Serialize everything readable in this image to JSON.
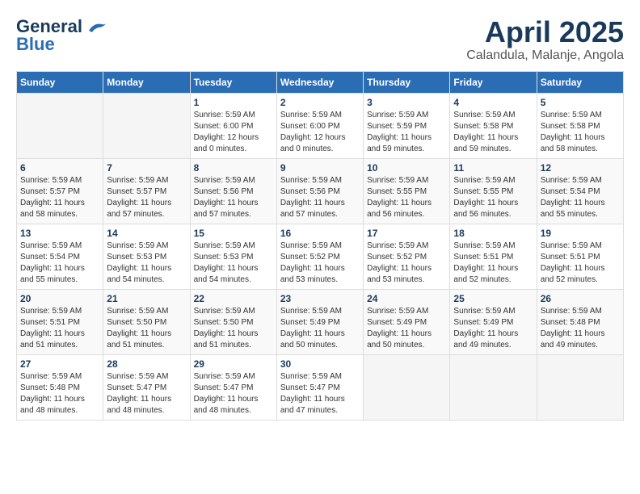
{
  "header": {
    "logo_line1": "General",
    "logo_line2": "Blue",
    "month": "April 2025",
    "location": "Calandula, Malanje, Angola"
  },
  "weekdays": [
    "Sunday",
    "Monday",
    "Tuesday",
    "Wednesday",
    "Thursday",
    "Friday",
    "Saturday"
  ],
  "weeks": [
    [
      {
        "day": "",
        "info": ""
      },
      {
        "day": "",
        "info": ""
      },
      {
        "day": "1",
        "info": "Sunrise: 5:59 AM\nSunset: 6:00 PM\nDaylight: 12 hours\nand 0 minutes."
      },
      {
        "day": "2",
        "info": "Sunrise: 5:59 AM\nSunset: 6:00 PM\nDaylight: 12 hours\nand 0 minutes."
      },
      {
        "day": "3",
        "info": "Sunrise: 5:59 AM\nSunset: 5:59 PM\nDaylight: 11 hours\nand 59 minutes."
      },
      {
        "day": "4",
        "info": "Sunrise: 5:59 AM\nSunset: 5:58 PM\nDaylight: 11 hours\nand 59 minutes."
      },
      {
        "day": "5",
        "info": "Sunrise: 5:59 AM\nSunset: 5:58 PM\nDaylight: 11 hours\nand 58 minutes."
      }
    ],
    [
      {
        "day": "6",
        "info": "Sunrise: 5:59 AM\nSunset: 5:57 PM\nDaylight: 11 hours\nand 58 minutes."
      },
      {
        "day": "7",
        "info": "Sunrise: 5:59 AM\nSunset: 5:57 PM\nDaylight: 11 hours\nand 57 minutes."
      },
      {
        "day": "8",
        "info": "Sunrise: 5:59 AM\nSunset: 5:56 PM\nDaylight: 11 hours\nand 57 minutes."
      },
      {
        "day": "9",
        "info": "Sunrise: 5:59 AM\nSunset: 5:56 PM\nDaylight: 11 hours\nand 57 minutes."
      },
      {
        "day": "10",
        "info": "Sunrise: 5:59 AM\nSunset: 5:55 PM\nDaylight: 11 hours\nand 56 minutes."
      },
      {
        "day": "11",
        "info": "Sunrise: 5:59 AM\nSunset: 5:55 PM\nDaylight: 11 hours\nand 56 minutes."
      },
      {
        "day": "12",
        "info": "Sunrise: 5:59 AM\nSunset: 5:54 PM\nDaylight: 11 hours\nand 55 minutes."
      }
    ],
    [
      {
        "day": "13",
        "info": "Sunrise: 5:59 AM\nSunset: 5:54 PM\nDaylight: 11 hours\nand 55 minutes."
      },
      {
        "day": "14",
        "info": "Sunrise: 5:59 AM\nSunset: 5:53 PM\nDaylight: 11 hours\nand 54 minutes."
      },
      {
        "day": "15",
        "info": "Sunrise: 5:59 AM\nSunset: 5:53 PM\nDaylight: 11 hours\nand 54 minutes."
      },
      {
        "day": "16",
        "info": "Sunrise: 5:59 AM\nSunset: 5:52 PM\nDaylight: 11 hours\nand 53 minutes."
      },
      {
        "day": "17",
        "info": "Sunrise: 5:59 AM\nSunset: 5:52 PM\nDaylight: 11 hours\nand 53 minutes."
      },
      {
        "day": "18",
        "info": "Sunrise: 5:59 AM\nSunset: 5:51 PM\nDaylight: 11 hours\nand 52 minutes."
      },
      {
        "day": "19",
        "info": "Sunrise: 5:59 AM\nSunset: 5:51 PM\nDaylight: 11 hours\nand 52 minutes."
      }
    ],
    [
      {
        "day": "20",
        "info": "Sunrise: 5:59 AM\nSunset: 5:51 PM\nDaylight: 11 hours\nand 51 minutes."
      },
      {
        "day": "21",
        "info": "Sunrise: 5:59 AM\nSunset: 5:50 PM\nDaylight: 11 hours\nand 51 minutes."
      },
      {
        "day": "22",
        "info": "Sunrise: 5:59 AM\nSunset: 5:50 PM\nDaylight: 11 hours\nand 51 minutes."
      },
      {
        "day": "23",
        "info": "Sunrise: 5:59 AM\nSunset: 5:49 PM\nDaylight: 11 hours\nand 50 minutes."
      },
      {
        "day": "24",
        "info": "Sunrise: 5:59 AM\nSunset: 5:49 PM\nDaylight: 11 hours\nand 50 minutes."
      },
      {
        "day": "25",
        "info": "Sunrise: 5:59 AM\nSunset: 5:49 PM\nDaylight: 11 hours\nand 49 minutes."
      },
      {
        "day": "26",
        "info": "Sunrise: 5:59 AM\nSunset: 5:48 PM\nDaylight: 11 hours\nand 49 minutes."
      }
    ],
    [
      {
        "day": "27",
        "info": "Sunrise: 5:59 AM\nSunset: 5:48 PM\nDaylight: 11 hours\nand 48 minutes."
      },
      {
        "day": "28",
        "info": "Sunrise: 5:59 AM\nSunset: 5:47 PM\nDaylight: 11 hours\nand 48 minutes."
      },
      {
        "day": "29",
        "info": "Sunrise: 5:59 AM\nSunset: 5:47 PM\nDaylight: 11 hours\nand 48 minutes."
      },
      {
        "day": "30",
        "info": "Sunrise: 5:59 AM\nSunset: 5:47 PM\nDaylight: 11 hours\nand 47 minutes."
      },
      {
        "day": "",
        "info": ""
      },
      {
        "day": "",
        "info": ""
      },
      {
        "day": "",
        "info": ""
      }
    ]
  ]
}
